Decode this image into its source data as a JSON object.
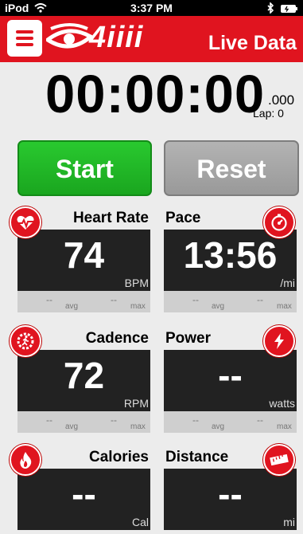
{
  "status_bar": {
    "device": "iPod",
    "time": "3:37 PM"
  },
  "app_bar": {
    "logo_text": "4iiii",
    "title": "Live Data"
  },
  "timer": {
    "clock": "00:00:00",
    "fraction": ".000",
    "lap_text": "Lap:  0"
  },
  "controls": {
    "start_label": "Start",
    "reset_label": "Reset"
  },
  "colors": {
    "brand_red": "#e0141f",
    "start_green": "#1fb525",
    "reset_gray": "#a6a6a6"
  },
  "tiles": {
    "heart_rate": {
      "label": "Heart Rate",
      "value": "74",
      "unit": "BPM",
      "avg": "--",
      "avg_label": "avg",
      "max": "--",
      "max_label": "max",
      "icon": "heart-rate-icon"
    },
    "pace": {
      "label": "Pace",
      "value": "13:56",
      "unit": "/mi",
      "avg": "--",
      "avg_label": "avg",
      "max": "--",
      "max_label": "max",
      "icon": "stopwatch-icon"
    },
    "cadence": {
      "label": "Cadence",
      "value": "72",
      "unit": "RPM",
      "avg": "--",
      "avg_label": "avg",
      "max": "--",
      "max_label": "max",
      "icon": "runner-gear-icon"
    },
    "power": {
      "label": "Power",
      "value": "--",
      "unit": "watts",
      "avg": "--",
      "avg_label": "avg",
      "max": "--",
      "max_label": "max",
      "icon": "lightning-icon"
    },
    "calories": {
      "label": "Calories",
      "value": "--",
      "unit": "Cal",
      "icon": "flame-icon"
    },
    "distance": {
      "label": "Distance",
      "value": "--",
      "unit": "mi",
      "icon": "ruler-icon"
    }
  }
}
